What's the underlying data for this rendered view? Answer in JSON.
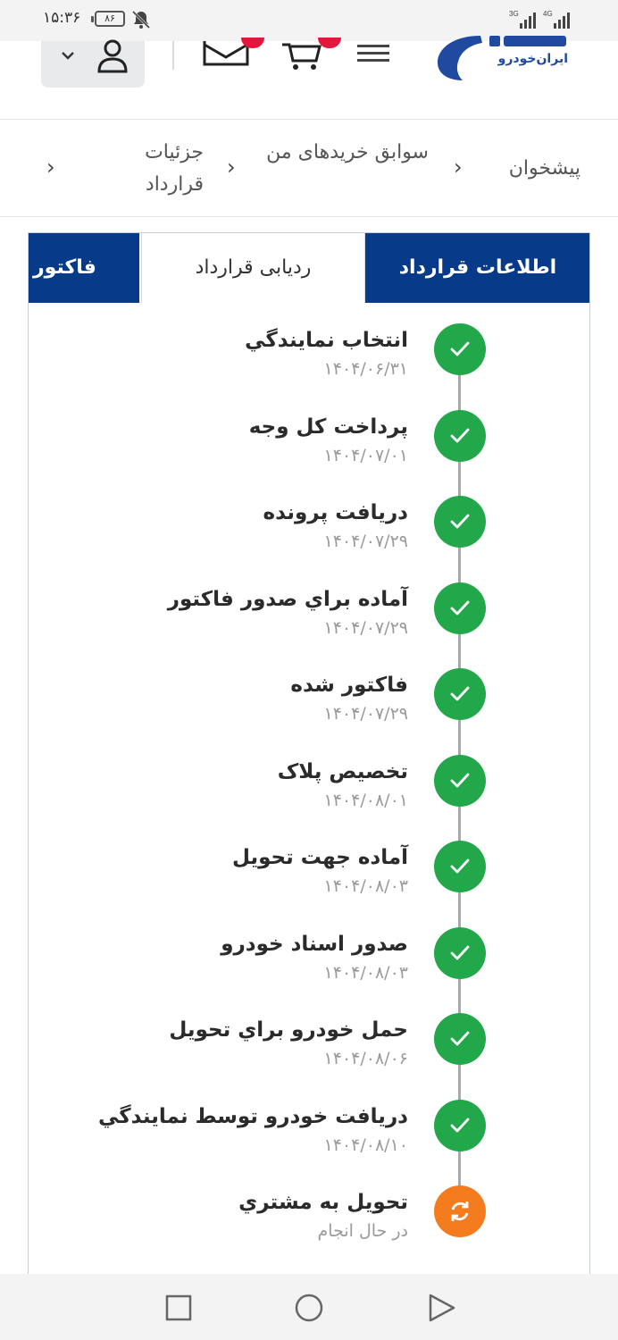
{
  "status_bar": {
    "time": "۱۵:۳۶",
    "battery": "۸۶",
    "network_1": "3G",
    "network_2": "4G"
  },
  "header": {
    "logo_text": "ايران‌خودرو"
  },
  "breadcrumb": {
    "items": [
      {
        "label": "پیشخوان"
      },
      {
        "label": "سوابق خریدهای من"
      },
      {
        "label": "جزئیات قرارداد"
      }
    ]
  },
  "tabs": [
    {
      "label": "اطلاعات قرارداد",
      "active": true
    },
    {
      "label": "ردیابی قرارداد",
      "active": false
    },
    {
      "label": "فاکتور",
      "active": true
    }
  ],
  "timeline": [
    {
      "title": "انتخاب نمايندگي",
      "date": "۱۴۰۴/۰۶/۳۱",
      "status": "done"
    },
    {
      "title": "پرداخت کل وجه",
      "date": "۱۴۰۴/۰۷/۰۱",
      "status": "done"
    },
    {
      "title": "دريافت پرونده",
      "date": "۱۴۰۴/۰۷/۲۹",
      "status": "done"
    },
    {
      "title": "آماده براي صدور فاکتور",
      "date": "۱۴۰۴/۰۷/۲۹",
      "status": "done"
    },
    {
      "title": "فاکتور شده",
      "date": "۱۴۰۴/۰۷/۲۹",
      "status": "done"
    },
    {
      "title": "تخصيص پلاک",
      "date": "۱۴۰۴/۰۸/۰۱",
      "status": "done"
    },
    {
      "title": "آماده جهت تحويل",
      "date": "۱۴۰۴/۰۸/۰۳",
      "status": "done"
    },
    {
      "title": "صدور اسناد خودرو",
      "date": "۱۴۰۴/۰۸/۰۳",
      "status": "done"
    },
    {
      "title": "حمل خودرو براي تحويل",
      "date": "۱۴۰۴/۰۸/۰۶",
      "status": "done"
    },
    {
      "title": "دريافت خودرو توسط نمايندگي",
      "date": "۱۴۰۴/۰۸/۱۰",
      "status": "done"
    },
    {
      "title": "تحويل به مشتري",
      "date": "در حال انجام",
      "status": "in-progress"
    }
  ],
  "colors": {
    "brand": "#073b8a",
    "done": "#22a84a",
    "in_progress": "#f47c1e",
    "badge": "#e2173e"
  },
  "icons": {
    "done": "check-icon",
    "in_progress": "refresh-icon"
  }
}
